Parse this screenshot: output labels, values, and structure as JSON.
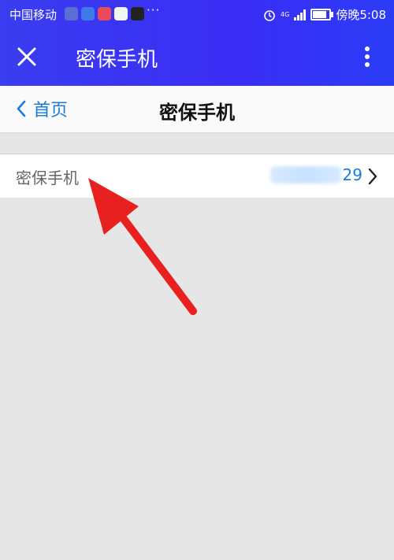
{
  "status_bar": {
    "carrier": "中国移动",
    "more": "···",
    "network": "4G",
    "time": "傍晚5:08"
  },
  "toolbar": {
    "title": "密保手机"
  },
  "nav": {
    "back_label": "首页",
    "title": "密保手机"
  },
  "row": {
    "label": "密保手机",
    "value_suffix": "29"
  },
  "colors": {
    "header_blue": "#3a36f2",
    "link_blue": "#1a7cd8",
    "arrow_red": "#e8201f"
  }
}
